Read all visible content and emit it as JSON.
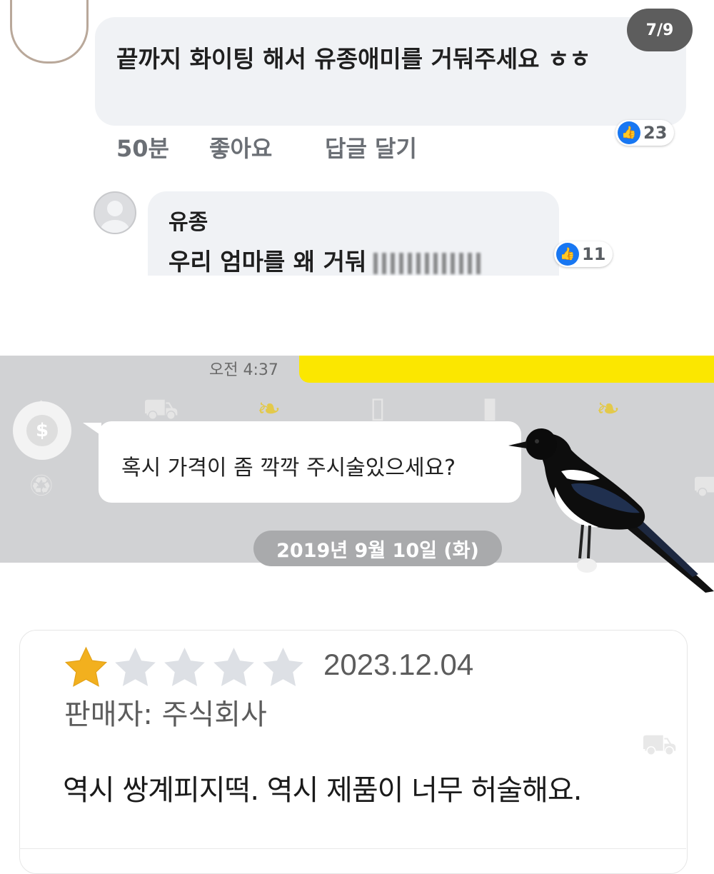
{
  "facebook": {
    "page_counter": "7/9",
    "comment": {
      "text": "끝까지 화이팅 해서 유종애미를 거둬주세요 ㅎㅎ",
      "time": "50분",
      "like_label": "좋아요",
      "reply_label": "답글 달기",
      "like_count": "23"
    },
    "reply": {
      "author": "유종",
      "text": "우리 엄마를 왜 거둬",
      "like_count": "11"
    }
  },
  "kakao": {
    "time": "오전 4:37",
    "message": "혹시 가격이 좀 깍깍 주시술있으세요?",
    "date_divider": "2019년 9월 10일 (화)",
    "accent_color": "#fbe700"
  },
  "review": {
    "rating": 1,
    "max_rating": 5,
    "date": "2023.12.04",
    "seller": "판매자: 주식회사",
    "text": "역시 쌍계피지떡. 역시 제품이 너무 허술해요.",
    "star_color": "#f2b01e"
  }
}
